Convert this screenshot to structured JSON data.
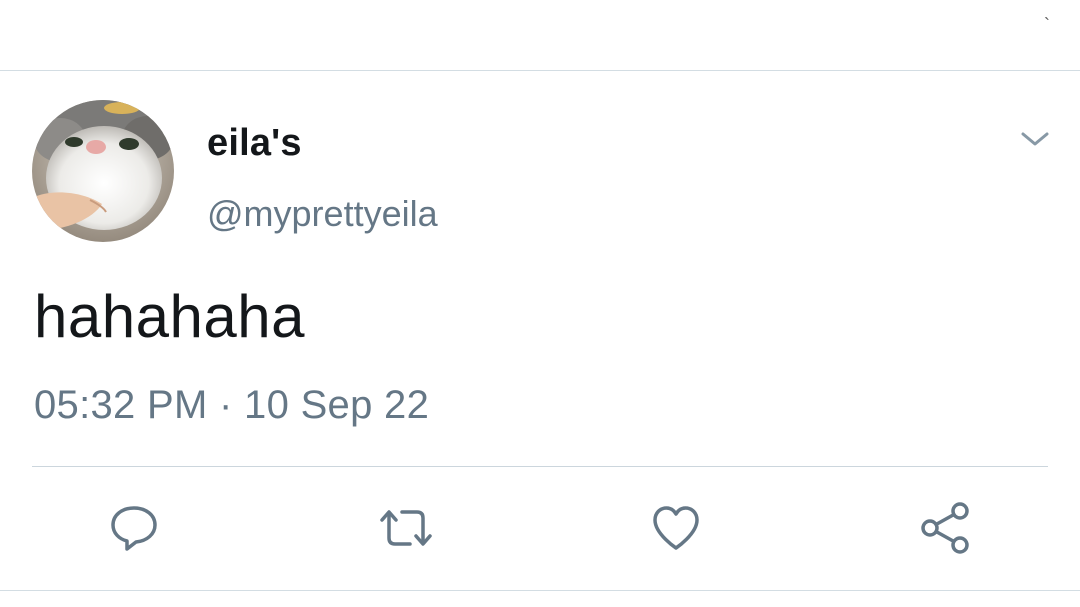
{
  "top": {
    "mark": "`"
  },
  "tweet": {
    "display_name": "eila's",
    "handle": "@myprettyeila",
    "text": "hahahaha",
    "timestamp": "05:32 PM · 10 Sep 22"
  },
  "icons": {
    "menu": "chevron-down-icon",
    "reply": "reply-icon",
    "retweet": "retweet-icon",
    "like": "heart-icon",
    "share": "share-icon"
  },
  "colors": {
    "text": "#14171a",
    "muted": "#657786",
    "icon": "#657786",
    "divider": "#ccd6dd"
  }
}
